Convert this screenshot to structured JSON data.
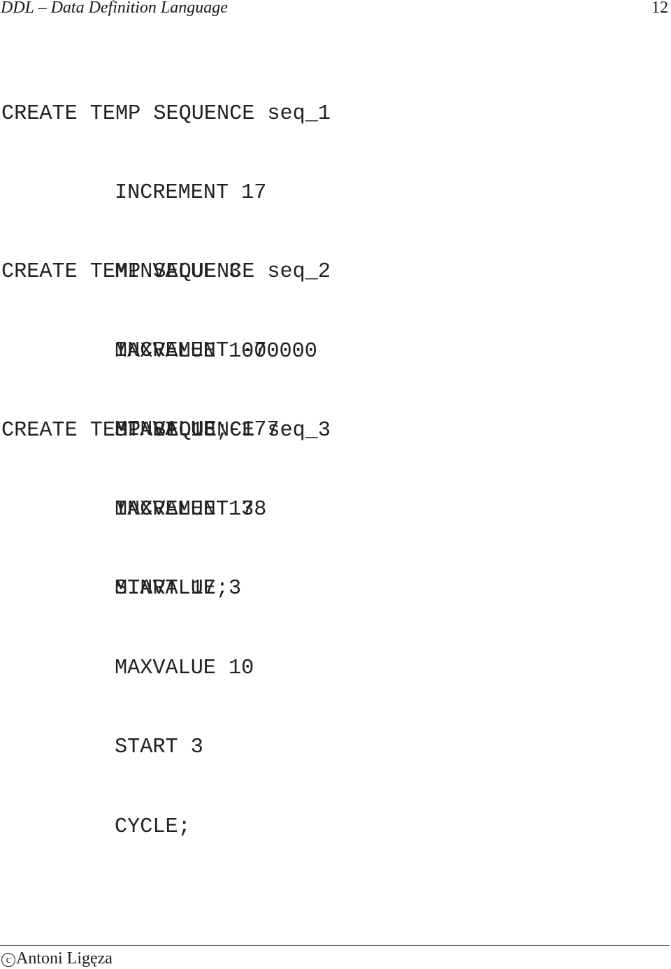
{
  "header": {
    "title": "DDL – Data Definition Language",
    "page_number": "12"
  },
  "code_blocks": [
    {
      "create": "CREATE TEMP SEQUENCE seq_1",
      "clauses": [
        "INCREMENT 17",
        "MINVALUE 3",
        "MAXVALUE 1000000",
        "START 13;"
      ]
    },
    {
      "create": "CREATE TEMP SEQUENCE seq_2",
      "clauses": [
        "INCREMENT -7",
        "MINVALUE -177",
        "MAXVALUE 178",
        "START 17;"
      ]
    },
    {
      "create": "CREATE TEMP SEQUENCE seq_3",
      "clauses": [
        "INCREMENT 3",
        "MINVALUE 3",
        "MAXVALUE 10",
        "START 3",
        "CYCLE;"
      ]
    }
  ],
  "footer": {
    "copyright_icon": "c",
    "author": "Antoni Ligęza"
  }
}
